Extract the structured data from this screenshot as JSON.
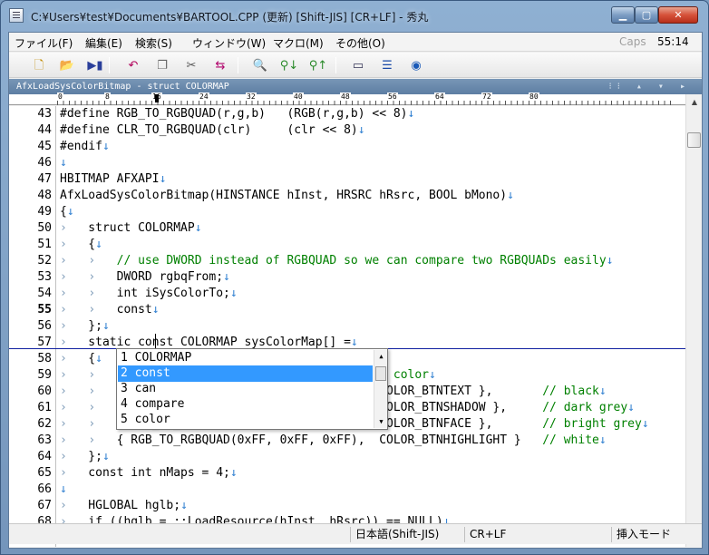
{
  "window": {
    "title": "C:¥Users¥test¥Documents¥BARTOOL.CPP (更新) [Shift-JIS] [CR+LF] - 秀丸"
  },
  "menu": {
    "items": [
      "ファイル(F)",
      "編集(E)",
      "検索(S)",
      "ウィンドウ(W)",
      "マクロ(M)",
      "その他(O)"
    ],
    "caps": "Caps",
    "clock": "55:14"
  },
  "toolbar": {
    "icons": [
      "new-file-icon",
      "open-folder-icon",
      "save-icon",
      "undo-icon",
      "copy-icon",
      "cut-icon",
      "paste-icon",
      "find-icon",
      "find-down-icon",
      "find-up-icon",
      "grep-icon",
      "split-window-icon",
      "help-icon"
    ]
  },
  "tab": {
    "title": "AfxLoadSysColorBitmap - struct COLORMAP",
    "icons": "⁝⁝ ▴ ▾ ▸"
  },
  "ruler": {
    "labels": [
      "0",
      "8",
      "16",
      "24",
      "32",
      "40",
      "48",
      "56",
      "64",
      "72",
      "80"
    ]
  },
  "editor": {
    "lines": [
      {
        "n": "43",
        "code": "#define RGB_TO_RGBQUAD(r,g,b)   (RGB(r,g,b) << 8)↓"
      },
      {
        "n": "44",
        "code": "#define CLR_TO_RGBQUAD(clr)     (clr << 8)↓"
      },
      {
        "n": "45",
        "code": "#endif↓"
      },
      {
        "n": "46",
        "code": "↓"
      },
      {
        "n": "47",
        "code": "HBITMAP AFXAPI↓"
      },
      {
        "n": "48",
        "code": "AfxLoadSysColorBitmap(HINSTANCE hInst, HRSRC hRsrc, BOOL bMono)↓"
      },
      {
        "n": "49",
        "code": "{↓"
      },
      {
        "n": "50",
        "code": "›   struct COLORMAP↓"
      },
      {
        "n": "51",
        "code": "›   {↓"
      },
      {
        "n": "52",
        "code": "›   ›   // use DWORD instead of RGBQUAD so we can compare two RGBQUADs easily↓"
      },
      {
        "n": "53",
        "code": "›   ›   DWORD rgbqFrom;↓"
      },
      {
        "n": "54",
        "code": "›   ›   int iSysColorTo;↓"
      },
      {
        "n": "55",
        "code": "›   ›   const↓"
      },
      {
        "n": "56",
        "code": "›   };↓"
      },
      {
        "n": "57",
        "code": "›   static const COLORMAP sysColorMap[] =↓"
      },
      {
        "n": "58",
        "code": "›   {↓"
      },
      {
        "n": "59",
        "code": "›   ›   // mapping from color in DIB to system color↓"
      },
      {
        "n": "60",
        "code": "›   ›   { RGB_TO_RGBQUAD(0x00, 0x00, 0x00),  COLOR_BTNTEXT },       // black↓"
      },
      {
        "n": "61",
        "code": "›   ›   { RGB_TO_RGBQUAD(0x80, 0x80, 0x80),  COLOR_BTNSHADOW },     // dark grey↓"
      },
      {
        "n": "62",
        "code": "›   ›   { RGB_TO_RGBQUAD(0xC0, 0xC0, 0xC0),  COLOR_BTNFACE },       // bright grey↓"
      },
      {
        "n": "63",
        "code": "›   ›   { RGB_TO_RGBQUAD(0xFF, 0xFF, 0xFF),  COLOR_BTNHIGHLIGHT }   // white↓"
      },
      {
        "n": "64",
        "code": "›   };↓"
      },
      {
        "n": "65",
        "code": "›   const int nMaps = 4;↓"
      },
      {
        "n": "66",
        "code": "↓"
      },
      {
        "n": "67",
        "code": "›   HGLOBAL hglb;↓"
      },
      {
        "n": "68",
        "code": "›   if ((hglb = ::LoadResource(hInst, hRsrc)) == NULL)↓"
      }
    ]
  },
  "completion": {
    "items": [
      "1 COLORMAP",
      "2 const",
      "3 can",
      "4 compare",
      "5 color"
    ],
    "selected_index": 1
  },
  "status": {
    "encoding": "日本語(Shift-JIS)",
    "newline": "CR+LF",
    "mode": "挿入モード"
  },
  "colors": {
    "comment": "#008000",
    "eol": "#2f7fd0",
    "selection": "#3399ff",
    "cursor_line": "#1020a0"
  }
}
